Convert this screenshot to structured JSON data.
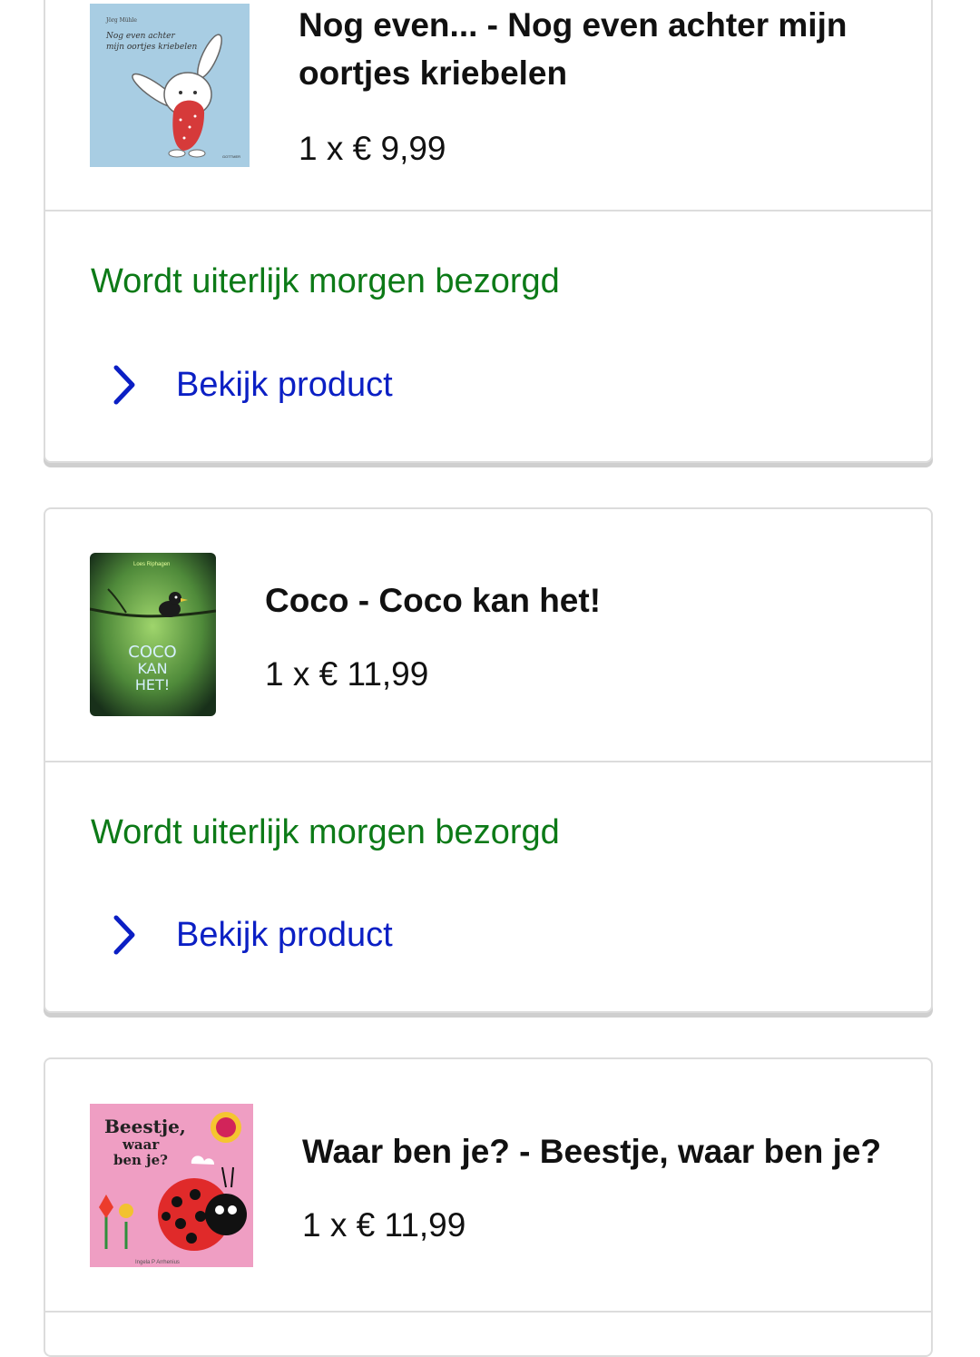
{
  "orders": [
    {
      "title": "Nog even... - Nog even achter mijn oortjes kriebelen",
      "price": "1 x € 9,99",
      "delivery": "Wordt uiterlijk morgen bezorgd",
      "link": "Bekijk product",
      "cover": {
        "text": "Nog even achter mijn oortjes kriebelen",
        "bg": "#a8cde3"
      }
    },
    {
      "title": "Coco - Coco kan het!",
      "price": "1 x € 11,99",
      "delivery": "Wordt uiterlijk morgen bezorgd",
      "link": "Bekijk product",
      "cover": {
        "text": "COCO KAN HET!",
        "bg": "#4f8a3a"
      }
    },
    {
      "title": "Waar ben je? - Beestje, waar ben je?",
      "price": "1 x € 11,99",
      "cover": {
        "text": "Beestje, waar ben je?",
        "bg": "#ef9ec3"
      }
    }
  ],
  "colors": {
    "delivery": "#0c7a17",
    "link": "#0b1fc4",
    "border": "#dcdcdc"
  },
  "icons": {
    "link": "chevron-right-icon"
  }
}
